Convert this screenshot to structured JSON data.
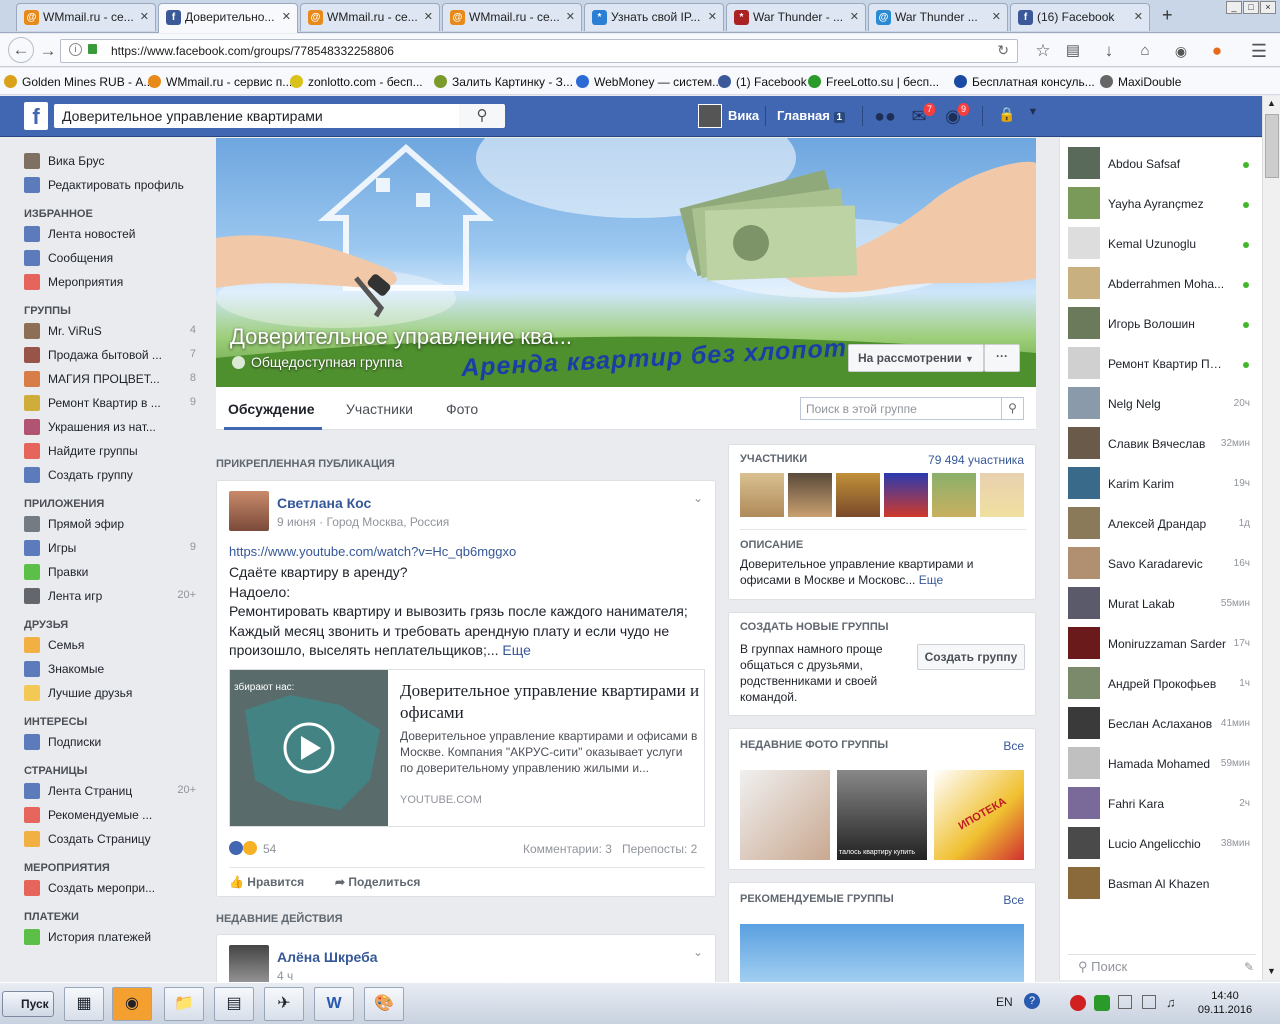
{
  "browser": {
    "tabs": [
      {
        "title": "WMmail.ru - се...",
        "icon": "at-sign-icon",
        "color": "#e88a1a",
        "active": false
      },
      {
        "title": "Доверительно...",
        "icon": "facebook-icon",
        "color": "#3b5998",
        "active": true
      },
      {
        "title": "WMmail.ru - се...",
        "icon": "at-sign-icon",
        "color": "#e88a1a",
        "active": false
      },
      {
        "title": "WMmail.ru - се...",
        "icon": "at-sign-icon",
        "color": "#e88a1a",
        "active": false
      },
      {
        "title": "Узнать свой IP...",
        "icon": "gear-icon",
        "color": "#2a7fd4",
        "active": false
      },
      {
        "title": "War Thunder - ...",
        "icon": "war-thunder-icon",
        "color": "#aa2222",
        "active": false
      },
      {
        "title": "War Thunder ...",
        "icon": "at-sign-icon",
        "color": "#2a8ad4",
        "active": false
      },
      {
        "title": "(16) Facebook",
        "icon": "facebook-icon",
        "color": "#3b5998",
        "active": false
      }
    ],
    "url": "https://www.facebook.com/groups/778548332258806",
    "bookmarks": [
      {
        "label": "Golden Mines RUB - А...",
        "color": "#d9a21a"
      },
      {
        "label": "WMmail.ru - сервис п...",
        "color": "#e88a1a"
      },
      {
        "label": "zonlotto.com - бесп...",
        "color": "#d9c21a"
      },
      {
        "label": "Залить Картинку - З...",
        "color": "#7a9a2a"
      },
      {
        "label": "WebMoney — систем...",
        "color": "#2a6ad4"
      },
      {
        "label": "(1) Facebook",
        "color": "#3b5998"
      },
      {
        "label": "FreeLotto.su | бесп...",
        "color": "#2a9a2a"
      },
      {
        "label": "Бесплатная консуль...",
        "color": "#1a4aa4"
      },
      {
        "label": "MaxiDouble",
        "color": "#666666"
      }
    ]
  },
  "fb": {
    "search_value": "Доверительное управление квартирами",
    "user_name": "Вика",
    "home_label": "Главная",
    "home_count": "1",
    "messages_badge": "7",
    "notifications_badge": "9"
  },
  "leftnav": {
    "profile_name": "Вика Брус",
    "edit_profile": "Редактировать профиль",
    "sections": [
      {
        "title": "ИЗБРАННОЕ",
        "items": [
          {
            "label": "Лента новостей",
            "count": "",
            "icon": "news-feed-icon",
            "color": "#4267b2"
          },
          {
            "label": "Сообщения",
            "count": "",
            "icon": "messages-icon",
            "color": "#4267b2"
          },
          {
            "label": "Мероприятия",
            "count": "",
            "icon": "calendar-icon",
            "color": "#e44d42"
          }
        ]
      },
      {
        "title": "ГРУППЫ",
        "items": [
          {
            "label": "Mr. ViRuS",
            "count": "4",
            "icon": "group-icon",
            "color": "#7a5a3a"
          },
          {
            "label": "Продажа бытовой ...",
            "count": "7",
            "icon": "group-icon",
            "color": "#8a3a2a"
          },
          {
            "label": "МАГИЯ ПРОЦВЕТ...",
            "count": "8",
            "icon": "group-icon",
            "color": "#d46a2a"
          },
          {
            "label": "Ремонт Квартир в ...",
            "count": "9",
            "icon": "group-icon",
            "color": "#c9a21a"
          },
          {
            "label": "Украшения из нат...",
            "count": "",
            "icon": "group-icon",
            "color": "#a63a5a"
          },
          {
            "label": "Найдите группы",
            "count": "",
            "icon": "compass-icon",
            "color": "#e44d42"
          },
          {
            "label": "Создать группу",
            "count": "",
            "icon": "plus-icon",
            "color": "#4267b2"
          }
        ]
      },
      {
        "title": "ПРИЛОЖЕНИЯ",
        "items": [
          {
            "label": "Прямой эфир",
            "count": "",
            "icon": "live-video-icon",
            "color": "#606770"
          },
          {
            "label": "Игры",
            "count": "9",
            "icon": "games-icon",
            "color": "#4267b2"
          },
          {
            "label": "Правки",
            "count": "",
            "icon": "pencil-icon",
            "color": "#42b72a"
          },
          {
            "label": "Лента игр",
            "count": "20+",
            "icon": "gamepad-icon",
            "color": "#4b4f56"
          }
        ]
      },
      {
        "title": "ДРУЗЬЯ",
        "items": [
          {
            "label": "Семья",
            "count": "",
            "icon": "star-icon",
            "color": "#f5a623"
          },
          {
            "label": "Знакомые",
            "count": "",
            "icon": "friends-icon",
            "color": "#4267b2"
          },
          {
            "label": "Лучшие друзья",
            "count": "",
            "icon": "star-icon",
            "color": "#f5c33b"
          }
        ]
      },
      {
        "title": "ИНТЕРЕСЫ",
        "items": [
          {
            "label": "Подписки",
            "count": "",
            "icon": "rss-icon",
            "color": "#4267b2"
          }
        ]
      },
      {
        "title": "СТРАНИЦЫ",
        "items": [
          {
            "label": "Лента Страниц",
            "count": "20+",
            "icon": "pages-feed-icon",
            "color": "#4267b2"
          },
          {
            "label": "Рекомендуемые ...",
            "count": "",
            "icon": "pages-icon",
            "color": "#e44d42"
          },
          {
            "label": "Создать Страницу",
            "count": "",
            "icon": "plus-page-icon",
            "color": "#f5a623"
          }
        ]
      },
      {
        "title": "МЕРОПРИЯТИЯ",
        "items": [
          {
            "label": "Создать меропри...",
            "count": "",
            "icon": "plus-event-icon",
            "color": "#e44d42"
          }
        ]
      },
      {
        "title": "ПЛАТЕЖИ",
        "items": [
          {
            "label": "История платежей",
            "count": "",
            "icon": "history-icon",
            "color": "#42b72a"
          }
        ]
      }
    ]
  },
  "group": {
    "title": "Доверительное управление ква...",
    "privacy": "Общедоступная группа",
    "cover_slogan": "Аренда  квартир  без  хлопот",
    "pending_button": "На рассмотрении",
    "more_button": "···",
    "tabs": [
      "Обсуждение",
      "Участники",
      "Фото"
    ],
    "search_placeholder": "Поиск в этой группе"
  },
  "pinned": {
    "section_label": "ПРИКРЕПЛЕННАЯ ПУБЛИКАЦИЯ",
    "author": "Светлана Кос",
    "meta": "9 июня · Город Москва, Россия",
    "link": "https://www.youtube.com/watch?v=Hc_qb6mggxo",
    "lines": [
      "Сдаёте квартиру в аренду?",
      "Надоело:",
      "Ремонтировать квартиру и вывозить грязь после каждого нанимателя;",
      "Каждый месяц звонить и требовать арендную плату и если чудо не",
      "произошло, выселять неплательщиков;..."
    ],
    "more_link": "Еще",
    "preview": {
      "image_caption": "збирают нас:",
      "title": "Доверительное управление квартирами и офисами",
      "description": "Доверительное управление квартирами и офисами в Москве. Компания \"АКРУС-сити\" оказывает услуги по доверительному управлению жилыми и...",
      "source": "YOUTUBE.COM"
    },
    "reactions_count": "54",
    "comments": "Комментарии: 3",
    "shares": "Перепосты: 2",
    "like_label": "Нравится",
    "share_label": "Поделиться"
  },
  "recent": {
    "section_label": "НЕДАВНИЕ ДЕЙСТВИЯ",
    "author": "Алёна Шкреба",
    "meta": "4 ч"
  },
  "sidebar": {
    "members_label": "УЧАСТНИКИ",
    "members_count": "79 494 участника",
    "description_label": "ОПИСАНИЕ",
    "description": "Доверительное управление квартирами и офисами в Москве и Московс...",
    "description_more": "Еще",
    "create_label": "СОЗДАТЬ НОВЫЕ ГРУППЫ",
    "create_text": "В группах намного проще общаться с друзьями, родственниками и своей командой.",
    "create_button": "Создать группу",
    "photos_label": "НЕДАВНИЕ ФОТО ГРУППЫ",
    "photos_all": "Все",
    "photo2_caption": "талось квартиру купить",
    "photo3_caption": "ИПОТЕКА",
    "recommended_label": "РЕКОМЕНДУЕМЫЕ ГРУППЫ",
    "recommended_all": "Все"
  },
  "chat": {
    "contacts": [
      {
        "name": "Abdou Safsaf",
        "status": "online"
      },
      {
        "name": "Yayha Ayrançmez",
        "status": "online"
      },
      {
        "name": "Kemal Uzunoglu",
        "status": "online"
      },
      {
        "name": "Abderrahmen Moha...",
        "status": "online"
      },
      {
        "name": "Игорь Волошин",
        "status": "online"
      },
      {
        "name": "Ремонт Квартир При...",
        "status": "online"
      },
      {
        "name": "Nelg Nelg",
        "status": "20ч"
      },
      {
        "name": "Славик Вячеслав",
        "status": "32мин"
      },
      {
        "name": "Karim Karim",
        "status": "19ч"
      },
      {
        "name": "Алексей Драндар",
        "status": "1д"
      },
      {
        "name": "Savo Karadarevic",
        "status": "16ч"
      },
      {
        "name": "Murat Lakab",
        "status": "55мин"
      },
      {
        "name": "Moniruzzaman Sarder",
        "status": "17ч"
      },
      {
        "name": "Андрей Прокофьев",
        "status": "1ч"
      },
      {
        "name": "Беслан Аслаханов",
        "status": "41мин"
      },
      {
        "name": "Hamada Mohamed",
        "status": "59мин"
      },
      {
        "name": "Fahri Kara",
        "status": "2ч"
      },
      {
        "name": "Lucio Angelicchio",
        "status": "38мин"
      },
      {
        "name": "Basman Al Khazen",
        "status": ""
      }
    ],
    "search_placeholder": "Поиск"
  },
  "taskbar": {
    "start_label": "Пуск",
    "lang": "EN",
    "time": "14:40",
    "date": "09.11.2016"
  }
}
